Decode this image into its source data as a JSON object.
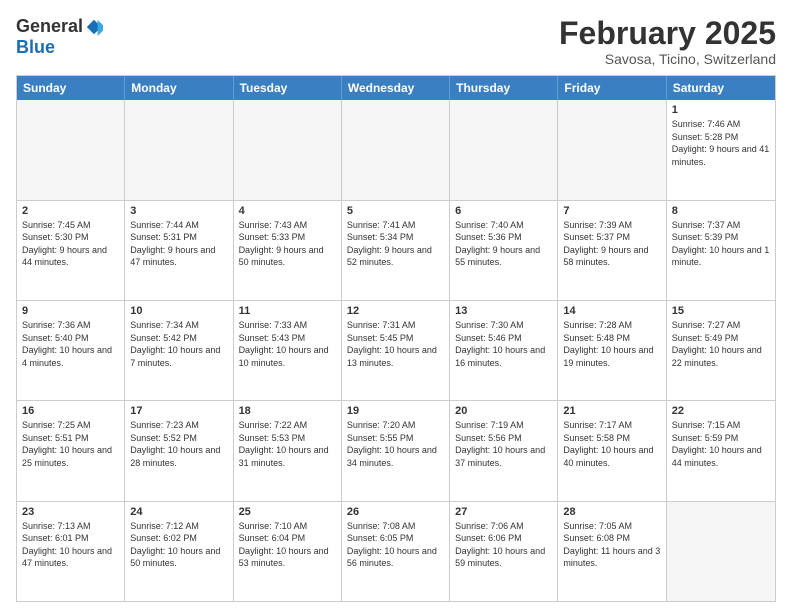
{
  "header": {
    "logo_general": "General",
    "logo_blue": "Blue",
    "month_title": "February 2025",
    "location": "Savosa, Ticino, Switzerland"
  },
  "day_headers": [
    "Sunday",
    "Monday",
    "Tuesday",
    "Wednesday",
    "Thursday",
    "Friday",
    "Saturday"
  ],
  "weeks": [
    [
      {
        "num": "",
        "info": "",
        "empty": true
      },
      {
        "num": "",
        "info": "",
        "empty": true
      },
      {
        "num": "",
        "info": "",
        "empty": true
      },
      {
        "num": "",
        "info": "",
        "empty": true
      },
      {
        "num": "",
        "info": "",
        "empty": true
      },
      {
        "num": "",
        "info": "",
        "empty": true
      },
      {
        "num": "1",
        "info": "Sunrise: 7:46 AM\nSunset: 5:28 PM\nDaylight: 9 hours and 41 minutes.",
        "empty": false
      }
    ],
    [
      {
        "num": "2",
        "info": "Sunrise: 7:45 AM\nSunset: 5:30 PM\nDaylight: 9 hours and 44 minutes.",
        "empty": false
      },
      {
        "num": "3",
        "info": "Sunrise: 7:44 AM\nSunset: 5:31 PM\nDaylight: 9 hours and 47 minutes.",
        "empty": false
      },
      {
        "num": "4",
        "info": "Sunrise: 7:43 AM\nSunset: 5:33 PM\nDaylight: 9 hours and 50 minutes.",
        "empty": false
      },
      {
        "num": "5",
        "info": "Sunrise: 7:41 AM\nSunset: 5:34 PM\nDaylight: 9 hours and 52 minutes.",
        "empty": false
      },
      {
        "num": "6",
        "info": "Sunrise: 7:40 AM\nSunset: 5:36 PM\nDaylight: 9 hours and 55 minutes.",
        "empty": false
      },
      {
        "num": "7",
        "info": "Sunrise: 7:39 AM\nSunset: 5:37 PM\nDaylight: 9 hours and 58 minutes.",
        "empty": false
      },
      {
        "num": "8",
        "info": "Sunrise: 7:37 AM\nSunset: 5:39 PM\nDaylight: 10 hours and 1 minute.",
        "empty": false
      }
    ],
    [
      {
        "num": "9",
        "info": "Sunrise: 7:36 AM\nSunset: 5:40 PM\nDaylight: 10 hours and 4 minutes.",
        "empty": false
      },
      {
        "num": "10",
        "info": "Sunrise: 7:34 AM\nSunset: 5:42 PM\nDaylight: 10 hours and 7 minutes.",
        "empty": false
      },
      {
        "num": "11",
        "info": "Sunrise: 7:33 AM\nSunset: 5:43 PM\nDaylight: 10 hours and 10 minutes.",
        "empty": false
      },
      {
        "num": "12",
        "info": "Sunrise: 7:31 AM\nSunset: 5:45 PM\nDaylight: 10 hours and 13 minutes.",
        "empty": false
      },
      {
        "num": "13",
        "info": "Sunrise: 7:30 AM\nSunset: 5:46 PM\nDaylight: 10 hours and 16 minutes.",
        "empty": false
      },
      {
        "num": "14",
        "info": "Sunrise: 7:28 AM\nSunset: 5:48 PM\nDaylight: 10 hours and 19 minutes.",
        "empty": false
      },
      {
        "num": "15",
        "info": "Sunrise: 7:27 AM\nSunset: 5:49 PM\nDaylight: 10 hours and 22 minutes.",
        "empty": false
      }
    ],
    [
      {
        "num": "16",
        "info": "Sunrise: 7:25 AM\nSunset: 5:51 PM\nDaylight: 10 hours and 25 minutes.",
        "empty": false
      },
      {
        "num": "17",
        "info": "Sunrise: 7:23 AM\nSunset: 5:52 PM\nDaylight: 10 hours and 28 minutes.",
        "empty": false
      },
      {
        "num": "18",
        "info": "Sunrise: 7:22 AM\nSunset: 5:53 PM\nDaylight: 10 hours and 31 minutes.",
        "empty": false
      },
      {
        "num": "19",
        "info": "Sunrise: 7:20 AM\nSunset: 5:55 PM\nDaylight: 10 hours and 34 minutes.",
        "empty": false
      },
      {
        "num": "20",
        "info": "Sunrise: 7:19 AM\nSunset: 5:56 PM\nDaylight: 10 hours and 37 minutes.",
        "empty": false
      },
      {
        "num": "21",
        "info": "Sunrise: 7:17 AM\nSunset: 5:58 PM\nDaylight: 10 hours and 40 minutes.",
        "empty": false
      },
      {
        "num": "22",
        "info": "Sunrise: 7:15 AM\nSunset: 5:59 PM\nDaylight: 10 hours and 44 minutes.",
        "empty": false
      }
    ],
    [
      {
        "num": "23",
        "info": "Sunrise: 7:13 AM\nSunset: 6:01 PM\nDaylight: 10 hours and 47 minutes.",
        "empty": false
      },
      {
        "num": "24",
        "info": "Sunrise: 7:12 AM\nSunset: 6:02 PM\nDaylight: 10 hours and 50 minutes.",
        "empty": false
      },
      {
        "num": "25",
        "info": "Sunrise: 7:10 AM\nSunset: 6:04 PM\nDaylight: 10 hours and 53 minutes.",
        "empty": false
      },
      {
        "num": "26",
        "info": "Sunrise: 7:08 AM\nSunset: 6:05 PM\nDaylight: 10 hours and 56 minutes.",
        "empty": false
      },
      {
        "num": "27",
        "info": "Sunrise: 7:06 AM\nSunset: 6:06 PM\nDaylight: 10 hours and 59 minutes.",
        "empty": false
      },
      {
        "num": "28",
        "info": "Sunrise: 7:05 AM\nSunset: 6:08 PM\nDaylight: 11 hours and 3 minutes.",
        "empty": false
      },
      {
        "num": "",
        "info": "",
        "empty": true
      }
    ]
  ]
}
